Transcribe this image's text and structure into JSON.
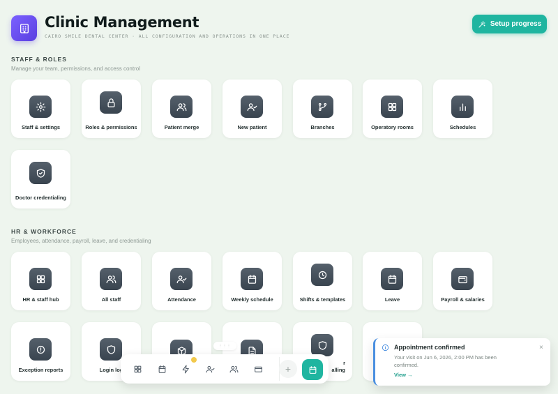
{
  "header": {
    "title": "Clinic Management",
    "subtitle": "Cairo Smile Dental Center · All configuration and operations in one place",
    "setup_label": "Setup progress",
    "app_icon": "building-icon",
    "accent_color": "#1fb5a0"
  },
  "sections": [
    {
      "title": "STAFF & ROLES",
      "description": "Manage your team, permissions, and access control",
      "cards": [
        {
          "label": "Staff & settings",
          "icon": "gear-icon"
        },
        {
          "label": "Roles & permissions",
          "icon": "lock-icon"
        },
        {
          "label": "Patient merge",
          "icon": "users-icon"
        },
        {
          "label": "New patient",
          "icon": "user-check-icon"
        },
        {
          "label": "Branches",
          "icon": "git-branch-icon"
        },
        {
          "label": "Operatory rooms",
          "icon": "grid-icon"
        },
        {
          "label": "Schedules",
          "icon": "bar-chart-icon"
        },
        {
          "label": "Doctor credentialing",
          "icon": "shield-check-icon"
        }
      ]
    },
    {
      "title": "HR & WORKFORCE",
      "description": "Employees, attendance, payroll, leave, and credentialing",
      "cards": [
        {
          "label": "HR & staff hub",
          "icon": "grid-icon"
        },
        {
          "label": "All staff",
          "icon": "users-icon"
        },
        {
          "label": "Attendance",
          "icon": "user-check-icon"
        },
        {
          "label": "Weekly schedule",
          "icon": "calendar-icon"
        },
        {
          "label": "Shifts & templates",
          "icon": "clock-icon"
        },
        {
          "label": "Leave",
          "icon": "calendar-icon"
        },
        {
          "label": "Payroll & salaries",
          "icon": "wallet-icon"
        },
        {
          "label": "Exception reports",
          "icon": "alert-icon"
        },
        {
          "label": "Login log",
          "icon": "shield-icon"
        },
        {
          "label": "",
          "icon": "box-icon"
        },
        {
          "label": "",
          "icon": "file-icon"
        },
        {
          "label": "r\nalling",
          "icon": "shield-icon"
        },
        {
          "label": "",
          "icon": ""
        }
      ]
    }
  ],
  "dock": {
    "handle": "⋮⋮⋮",
    "items": [
      "grid-icon",
      "calendar-icon",
      "bolt-icon",
      "user-check-icon",
      "users-icon",
      "card-icon"
    ],
    "add_label": "+",
    "primary_icon": "calendar-icon"
  },
  "toast": {
    "title": "Appointment confirmed",
    "message": "Your visit on Jun 6, 2026, 2:00 PM has been confirmed.",
    "link": "View →",
    "close": "×",
    "accent_color": "#4a8fe0"
  }
}
